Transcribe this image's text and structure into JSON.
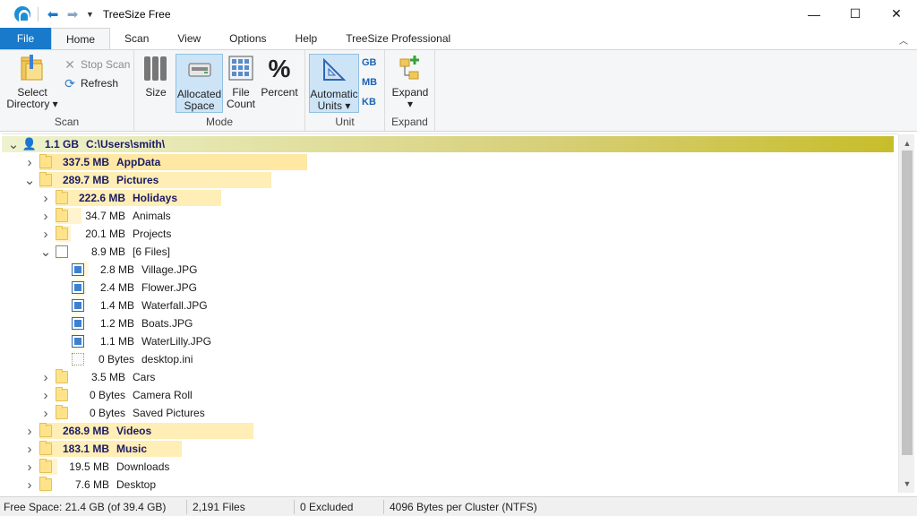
{
  "window": {
    "title": "TreeSize Free",
    "controls": [
      "—",
      "☐",
      "✕"
    ]
  },
  "tabs": [
    {
      "label": "File"
    },
    {
      "label": "Home"
    },
    {
      "label": "Scan"
    },
    {
      "label": "View"
    },
    {
      "label": "Options"
    },
    {
      "label": "Help"
    },
    {
      "label": "TreeSize Professional"
    }
  ],
  "ribbon": {
    "scan": {
      "label": "Scan",
      "select_directory_line1": "Select",
      "select_directory_line2": "Directory",
      "stop_scan": "Stop Scan",
      "refresh": "Refresh"
    },
    "mode": {
      "label": "Mode",
      "size": "Size",
      "allocated_line1": "Allocated",
      "allocated_line2": "Space",
      "file_count_line1": "File",
      "file_count_line2": "Count",
      "percent": "Percent"
    },
    "unit": {
      "label": "Unit",
      "auto_line1": "Automatic",
      "auto_line2": "Units",
      "gb": "GB",
      "mb": "MB",
      "kb": "KB"
    },
    "expand": {
      "label": "Expand",
      "expand_button": "Expand"
    }
  },
  "tree": {
    "rows": [
      {
        "size": "1.1 GB",
        "name": "C:\\Users\\smith\\",
        "level": 0,
        "expander": "open",
        "icon": "user",
        "bold": true,
        "bar": 1.0,
        "bar_color": "#c7bd2b"
      },
      {
        "size": "337.5 MB",
        "name": "AppData",
        "level": 1,
        "expander": "closed",
        "icon": "folder",
        "bold": true,
        "bar": 0.3,
        "bar_color": "#ffe8a3"
      },
      {
        "size": "289.7 MB",
        "name": "Pictures",
        "level": 1,
        "expander": "open",
        "icon": "folder",
        "bold": true,
        "bar": 0.26,
        "bar_color": "#ffeeb5"
      },
      {
        "size": "222.6 MB",
        "name": "Holidays",
        "level": 2,
        "expander": "closed",
        "icon": "folder",
        "bold": true,
        "bar": 0.77,
        "bar_color": "#ffeeb5"
      },
      {
        "size": "34.7 MB",
        "name": "Animals",
        "level": 2,
        "expander": "closed",
        "icon": "folder",
        "bold": false,
        "bar": 0.12,
        "bar_color": "#fff4cf"
      },
      {
        "size": "20.1 MB",
        "name": "Projects",
        "level": 2,
        "expander": "closed",
        "icon": "folder",
        "bold": false,
        "bar": 0.07,
        "bar_color": "#fff4cf"
      },
      {
        "size": "8.9 MB",
        "name": "[6 Files]",
        "level": 2,
        "expander": "open",
        "icon": "file",
        "bold": false,
        "bar": 0.03,
        "bar_color": "#fff8e0"
      },
      {
        "size": "2.8 MB",
        "name": "Village.JPG",
        "level": 3,
        "expander": "none",
        "icon": "image",
        "bold": false,
        "bar": 0.31,
        "bar_color": "#fff8e0"
      },
      {
        "size": "2.4 MB",
        "name": "Flower.JPG",
        "level": 3,
        "expander": "none",
        "icon": "image",
        "bold": false,
        "bar": 0.27,
        "bar_color": "#fff8e0"
      },
      {
        "size": "1.4 MB",
        "name": "Waterfall.JPG",
        "level": 3,
        "expander": "none",
        "icon": "image",
        "bold": false,
        "bar": 0.16,
        "bar_color": "#fff8e0"
      },
      {
        "size": "1.2 MB",
        "name": "Boats.JPG",
        "level": 3,
        "expander": "none",
        "icon": "image",
        "bold": false,
        "bar": 0.13,
        "bar_color": "#fff8e0"
      },
      {
        "size": "1.1 MB",
        "name": "WaterLilly.JPG",
        "level": 3,
        "expander": "none",
        "icon": "image",
        "bold": false,
        "bar": 0.12,
        "bar_color": "#fff8e0"
      },
      {
        "size": "0 Bytes",
        "name": "desktop.ini",
        "level": 3,
        "expander": "none",
        "icon": "ini",
        "bold": false,
        "bar": 0,
        "bar_color": "#fff8e0"
      },
      {
        "size": "3.5 MB",
        "name": "Cars",
        "level": 2,
        "expander": "closed",
        "icon": "folder",
        "bold": false,
        "bar": 0.01,
        "bar_color": "#fff8e0"
      },
      {
        "size": "0 Bytes",
        "name": "Camera Roll",
        "level": 2,
        "expander": "closed",
        "icon": "folder",
        "bold": false,
        "bar": 0,
        "bar_color": "#fff8e0"
      },
      {
        "size": "0 Bytes",
        "name": "Saved Pictures",
        "level": 2,
        "expander": "closed",
        "icon": "folder",
        "bold": false,
        "bar": 0,
        "bar_color": "#fff8e0"
      },
      {
        "size": "268.9 MB",
        "name": "Videos",
        "level": 1,
        "expander": "closed",
        "icon": "folder",
        "bold": true,
        "bar": 0.24,
        "bar_color": "#ffeeb5"
      },
      {
        "size": "183.1 MB",
        "name": "Music",
        "level": 1,
        "expander": "closed",
        "icon": "folder",
        "bold": true,
        "bar": 0.16,
        "bar_color": "#ffeeb5"
      },
      {
        "size": "19.5 MB",
        "name": "Downloads",
        "level": 1,
        "expander": "closed",
        "icon": "folder",
        "bold": false,
        "bar": 0.02,
        "bar_color": "#fff4cf"
      },
      {
        "size": "7.6 MB",
        "name": "Desktop",
        "level": 1,
        "expander": "closed",
        "icon": "folder",
        "bold": false,
        "bar": 0.01,
        "bar_color": "#fff8e0"
      }
    ]
  },
  "status": {
    "free_space": "Free Space: 21.4 GB  (of 39.4 GB)",
    "files": "2,191  Files",
    "excluded": "0 Excluded",
    "cluster": "4096  Bytes per Cluster (NTFS)"
  }
}
